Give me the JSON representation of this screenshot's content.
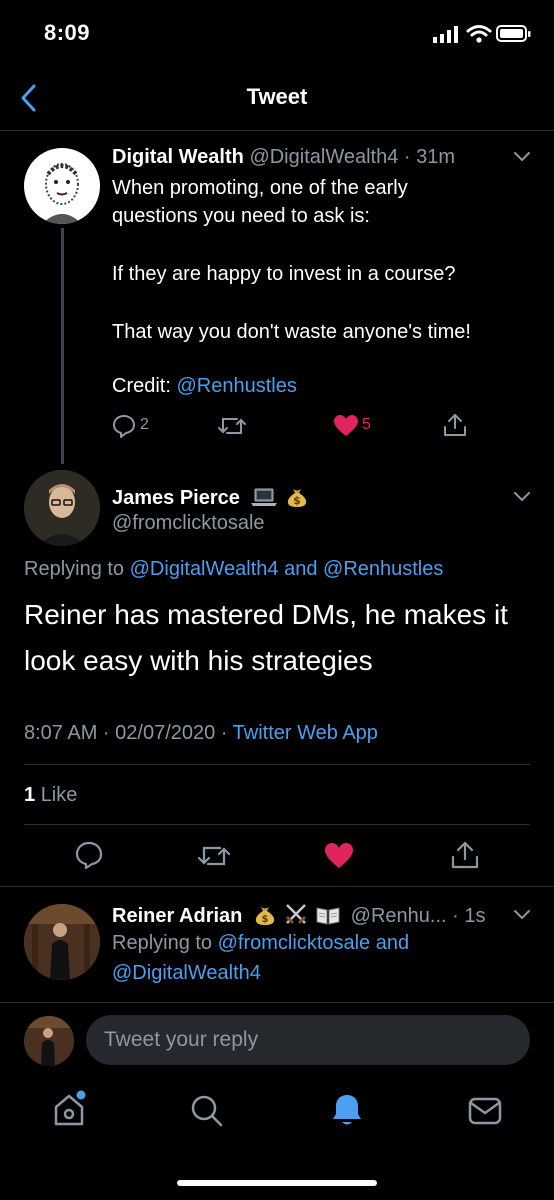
{
  "status_bar": {
    "time": "8:09"
  },
  "header": {
    "title": "Tweet"
  },
  "tweet_parent": {
    "display_name": "Digital Wealth",
    "handle_time": "@DigitalWealth4 · 31m",
    "lines": [
      "When promoting, one of the early",
      "questions you need to ask is:",
      "If they are happy to invest in a course?",
      "That way you don't waste anyone's time!"
    ],
    "credit_label": "Credit:",
    "credit_mention": "@Renhustles",
    "reply_count": "2",
    "like_count": "5"
  },
  "tweet_main": {
    "display_name": "James Pierce",
    "handle": "@fromclicktosale",
    "replying_prefix": "Replying to",
    "replying_mention_1": "@DigitalWealth4",
    "replying_and": "and",
    "replying_mention_2": "@Renhustles",
    "text_line_1": "Reiner has mastered DMs, he makes it",
    "text_line_2": "look easy with his strategies",
    "timestamp": "8:07 AM · 02/07/2020 ·",
    "source": "Twitter Web App",
    "likes_count": "1",
    "likes_label": "Like"
  },
  "tweet_reply": {
    "display_name": "Reiner Adrian",
    "handle_time": "@Renhu... · 1s",
    "replying_prefix": "Replying to",
    "replying_mention_1": "@fromclicktosale",
    "replying_and": "and",
    "replying_mention_2": "@DigitalWealth4"
  },
  "composer": {
    "placeholder": "Tweet your reply"
  },
  "colors": {
    "accent": "#4a9ff0",
    "like": "#e0245e",
    "muted": "#8b98a5",
    "background": "#000000"
  },
  "tab_bar": {
    "items": [
      "home-icon",
      "search-icon",
      "notifications-icon",
      "messages-icon"
    ]
  }
}
